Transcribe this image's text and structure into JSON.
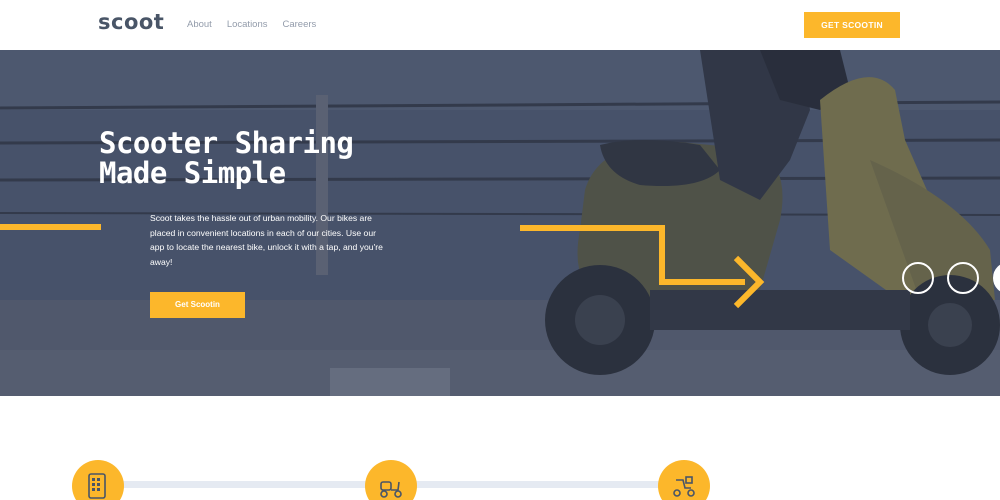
{
  "header": {
    "logo": "scoot",
    "nav": [
      "About",
      "Locations",
      "Careers"
    ],
    "cta_label": "GET SCOOTIN"
  },
  "hero": {
    "title_line1": "Scooter Sharing",
    "title_line2": "Made Simple",
    "description": "Scoot takes the hassle out of urban mobility. Our bikes are placed in convenient locations in each of our cities. Use our app to locate the nearest bike, unlock it with a tap, and you're away!",
    "button_label": "Get Scootin"
  },
  "steps": {
    "icons": [
      "phone-locate-icon",
      "scooter-icon",
      "ride-icon"
    ]
  },
  "colors": {
    "accent": "#fcb72b",
    "text_dark": "#495567",
    "nav_text": "#939cab",
    "hero_overlay": "#4b5568"
  }
}
